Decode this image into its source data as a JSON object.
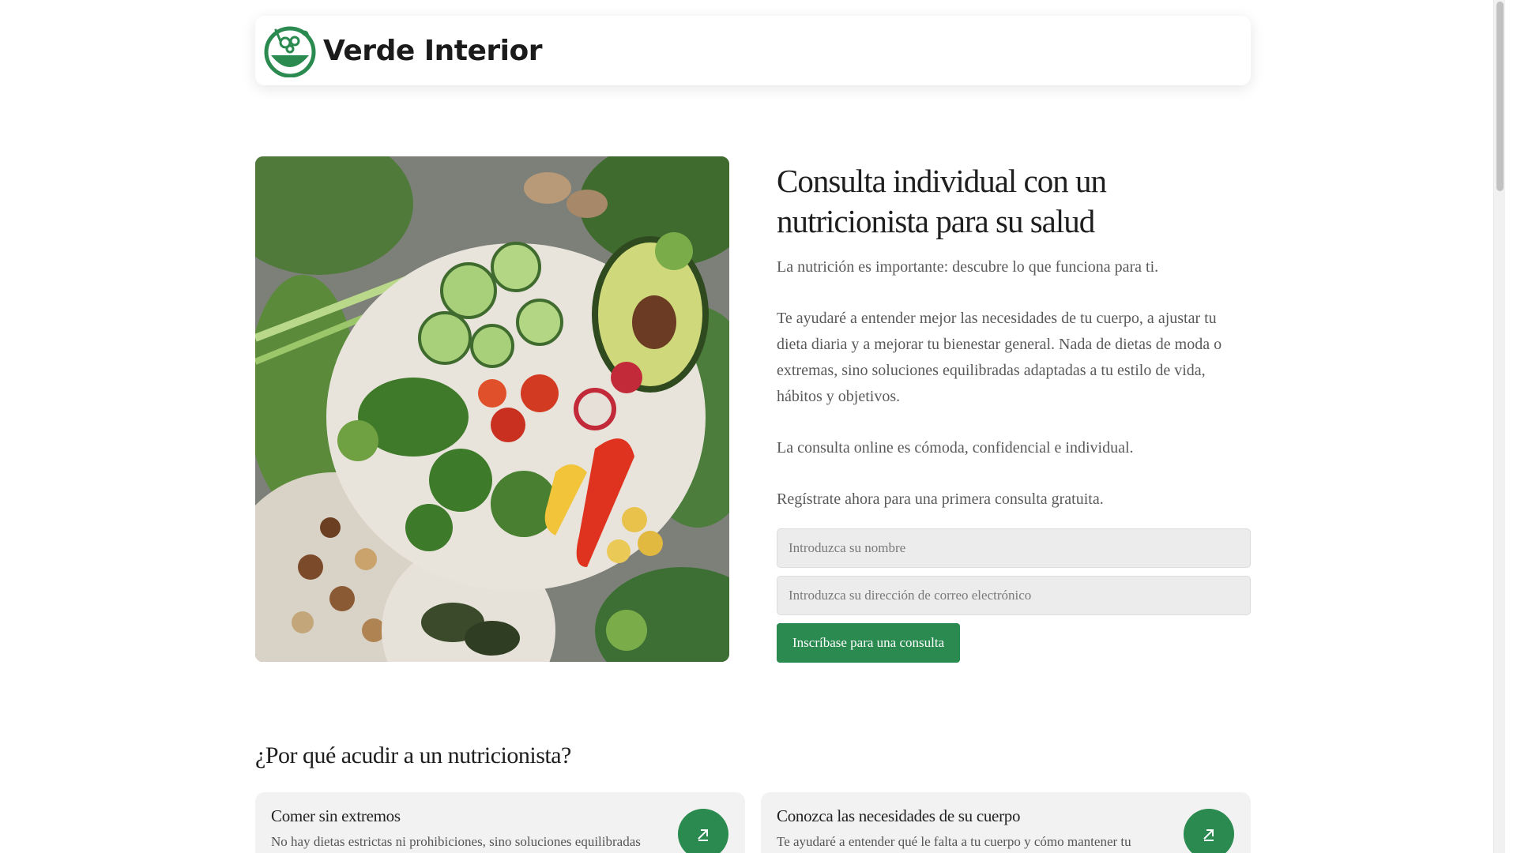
{
  "brand": {
    "name": "Verde Interior",
    "accent": "#2a8a4f",
    "logo_icon": "bowl-leaf-icon"
  },
  "hero": {
    "image_icon": "vegetables-plate-image",
    "title": "Consulta individual con un nutricionista para su salud",
    "paragraphs": [
      "La nutrición es importante: descubre lo que funciona para ti.",
      "Te ayudaré a entender mejor las necesidades de tu cuerpo, a ajustar tu dieta diaria y a mejorar tu bienestar general. Nada de dietas de moda o extremas, sino soluciones equilibradas adaptadas a tu estilo de vida, hábitos y objetivos.",
      "La consulta online es cómoda, confidencial e individual.",
      "Regístrate ahora para una primera consulta gratuita."
    ],
    "form": {
      "name_placeholder": "Introduzca su nombre",
      "email_placeholder": "Introduzca su dirección de correo electrónico",
      "submit_label": "Inscríbase para una consulta"
    }
  },
  "why": {
    "title": "¿Por qué acudir a un nutricionista?",
    "cards": [
      {
        "title": "Comer sin extremos",
        "text": "No hay dietas estrictas ni prohibiciones, sino soluciones equilibradas",
        "icon": "arrow-up-right-icon"
      },
      {
        "title": "Conozca las necesidades de su cuerpo",
        "text": "Te ayudaré a entender qué le falta a tu cuerpo y cómo mantener tu",
        "icon": "arrow-up-right-icon"
      }
    ]
  }
}
